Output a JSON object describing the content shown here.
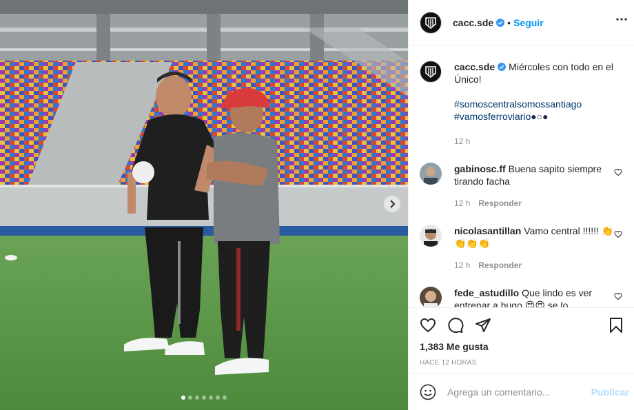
{
  "post": {
    "author": "cacc.sde",
    "follow_label": "Seguir",
    "separator": "•",
    "icons": {
      "more": "more-icon",
      "verified": "verified-badge-icon",
      "next": "chevron-right-icon"
    }
  },
  "caption": {
    "user": "cacc.sde",
    "text": "Miércoles con todo en el Único!",
    "hashtag1": "#somoscentralsomossantiago",
    "hashtag2": "#vamosferroviario",
    "emoji": "●○●",
    "time": "12 h"
  },
  "comments": [
    {
      "user": "gabinosc.ff",
      "text": "Buena sapito siempre tirando facha",
      "time": "12 h",
      "reply": "Responder"
    },
    {
      "user": "nicolasantillan",
      "text": "Vamo central !!!!!! 👏👏👏👏",
      "time": "12 h",
      "reply": "Responder"
    },
    {
      "user": "fede_astudillo",
      "text": "Que lindo es ver entrenar a hugo 😍😍 se lo"
    }
  ],
  "actions": {
    "likes": "1,383 Me gusta",
    "timestamp": "HACE 12 HORAS",
    "icons": [
      "heart-icon",
      "comment-icon",
      "share-icon",
      "bookmark-icon"
    ]
  },
  "add_comment": {
    "placeholder": "Agrega un comentario...",
    "publish_label": "Publicar"
  },
  "carousel": {
    "slides": 7,
    "active": 1
  },
  "colors": {
    "accent": "#0095f6",
    "muted": "#8e8e8e",
    "publish_disabled": "#b2dffc",
    "text": "#262626"
  }
}
